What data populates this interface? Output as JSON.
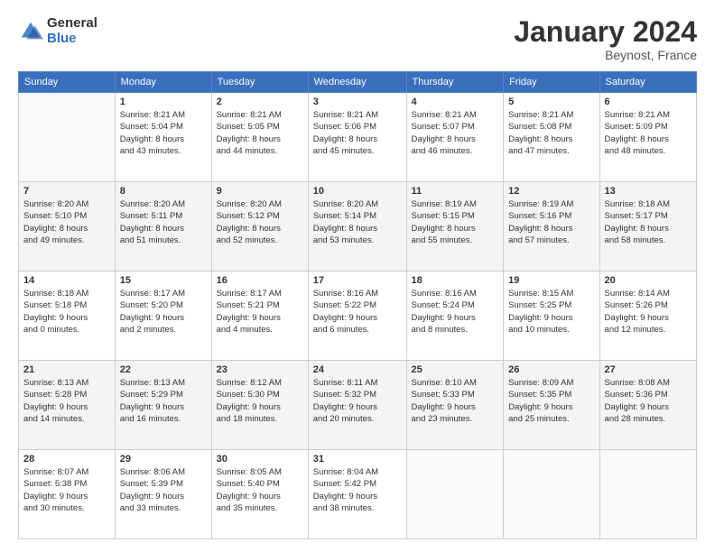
{
  "logo": {
    "general": "General",
    "blue": "Blue"
  },
  "title": "January 2024",
  "location": "Beynost, France",
  "days_header": [
    "Sunday",
    "Monday",
    "Tuesday",
    "Wednesday",
    "Thursday",
    "Friday",
    "Saturday"
  ],
  "weeks": [
    [
      {
        "num": "",
        "info": ""
      },
      {
        "num": "1",
        "info": "Sunrise: 8:21 AM\nSunset: 5:04 PM\nDaylight: 8 hours\nand 43 minutes."
      },
      {
        "num": "2",
        "info": "Sunrise: 8:21 AM\nSunset: 5:05 PM\nDaylight: 8 hours\nand 44 minutes."
      },
      {
        "num": "3",
        "info": "Sunrise: 8:21 AM\nSunset: 5:06 PM\nDaylight: 8 hours\nand 45 minutes."
      },
      {
        "num": "4",
        "info": "Sunrise: 8:21 AM\nSunset: 5:07 PM\nDaylight: 8 hours\nand 46 minutes."
      },
      {
        "num": "5",
        "info": "Sunrise: 8:21 AM\nSunset: 5:08 PM\nDaylight: 8 hours\nand 47 minutes."
      },
      {
        "num": "6",
        "info": "Sunrise: 8:21 AM\nSunset: 5:09 PM\nDaylight: 8 hours\nand 48 minutes."
      }
    ],
    [
      {
        "num": "7",
        "info": "Sunrise: 8:20 AM\nSunset: 5:10 PM\nDaylight: 8 hours\nand 49 minutes."
      },
      {
        "num": "8",
        "info": "Sunrise: 8:20 AM\nSunset: 5:11 PM\nDaylight: 8 hours\nand 51 minutes."
      },
      {
        "num": "9",
        "info": "Sunrise: 8:20 AM\nSunset: 5:12 PM\nDaylight: 8 hours\nand 52 minutes."
      },
      {
        "num": "10",
        "info": "Sunrise: 8:20 AM\nSunset: 5:14 PM\nDaylight: 8 hours\nand 53 minutes."
      },
      {
        "num": "11",
        "info": "Sunrise: 8:19 AM\nSunset: 5:15 PM\nDaylight: 8 hours\nand 55 minutes."
      },
      {
        "num": "12",
        "info": "Sunrise: 8:19 AM\nSunset: 5:16 PM\nDaylight: 8 hours\nand 57 minutes."
      },
      {
        "num": "13",
        "info": "Sunrise: 8:18 AM\nSunset: 5:17 PM\nDaylight: 8 hours\nand 58 minutes."
      }
    ],
    [
      {
        "num": "14",
        "info": "Sunrise: 8:18 AM\nSunset: 5:18 PM\nDaylight: 9 hours\nand 0 minutes."
      },
      {
        "num": "15",
        "info": "Sunrise: 8:17 AM\nSunset: 5:20 PM\nDaylight: 9 hours\nand 2 minutes."
      },
      {
        "num": "16",
        "info": "Sunrise: 8:17 AM\nSunset: 5:21 PM\nDaylight: 9 hours\nand 4 minutes."
      },
      {
        "num": "17",
        "info": "Sunrise: 8:16 AM\nSunset: 5:22 PM\nDaylight: 9 hours\nand 6 minutes."
      },
      {
        "num": "18",
        "info": "Sunrise: 8:16 AM\nSunset: 5:24 PM\nDaylight: 9 hours\nand 8 minutes."
      },
      {
        "num": "19",
        "info": "Sunrise: 8:15 AM\nSunset: 5:25 PM\nDaylight: 9 hours\nand 10 minutes."
      },
      {
        "num": "20",
        "info": "Sunrise: 8:14 AM\nSunset: 5:26 PM\nDaylight: 9 hours\nand 12 minutes."
      }
    ],
    [
      {
        "num": "21",
        "info": "Sunrise: 8:13 AM\nSunset: 5:28 PM\nDaylight: 9 hours\nand 14 minutes."
      },
      {
        "num": "22",
        "info": "Sunrise: 8:13 AM\nSunset: 5:29 PM\nDaylight: 9 hours\nand 16 minutes."
      },
      {
        "num": "23",
        "info": "Sunrise: 8:12 AM\nSunset: 5:30 PM\nDaylight: 9 hours\nand 18 minutes."
      },
      {
        "num": "24",
        "info": "Sunrise: 8:11 AM\nSunset: 5:32 PM\nDaylight: 9 hours\nand 20 minutes."
      },
      {
        "num": "25",
        "info": "Sunrise: 8:10 AM\nSunset: 5:33 PM\nDaylight: 9 hours\nand 23 minutes."
      },
      {
        "num": "26",
        "info": "Sunrise: 8:09 AM\nSunset: 5:35 PM\nDaylight: 9 hours\nand 25 minutes."
      },
      {
        "num": "27",
        "info": "Sunrise: 8:08 AM\nSunset: 5:36 PM\nDaylight: 9 hours\nand 28 minutes."
      }
    ],
    [
      {
        "num": "28",
        "info": "Sunrise: 8:07 AM\nSunset: 5:38 PM\nDaylight: 9 hours\nand 30 minutes."
      },
      {
        "num": "29",
        "info": "Sunrise: 8:06 AM\nSunset: 5:39 PM\nDaylight: 9 hours\nand 33 minutes."
      },
      {
        "num": "30",
        "info": "Sunrise: 8:05 AM\nSunset: 5:40 PM\nDaylight: 9 hours\nand 35 minutes."
      },
      {
        "num": "31",
        "info": "Sunrise: 8:04 AM\nSunset: 5:42 PM\nDaylight: 9 hours\nand 38 minutes."
      },
      {
        "num": "",
        "info": ""
      },
      {
        "num": "",
        "info": ""
      },
      {
        "num": "",
        "info": ""
      }
    ]
  ]
}
